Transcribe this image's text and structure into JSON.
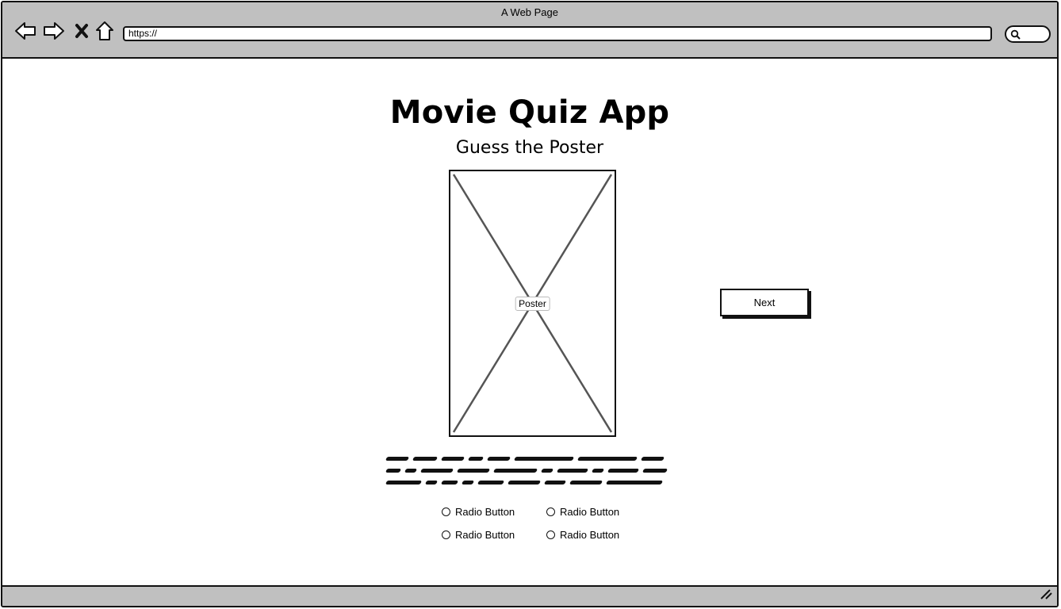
{
  "browser": {
    "title": "A Web Page",
    "url": "https://"
  },
  "page": {
    "title": "Movie Quiz App",
    "subtitle": "Guess the Poster",
    "poster_label": "Poster",
    "next_label": "Next",
    "radios": [
      {
        "label": "Radio Button"
      },
      {
        "label": "Radio Button"
      },
      {
        "label": "Radio Button"
      },
      {
        "label": "Radio Button"
      }
    ]
  }
}
